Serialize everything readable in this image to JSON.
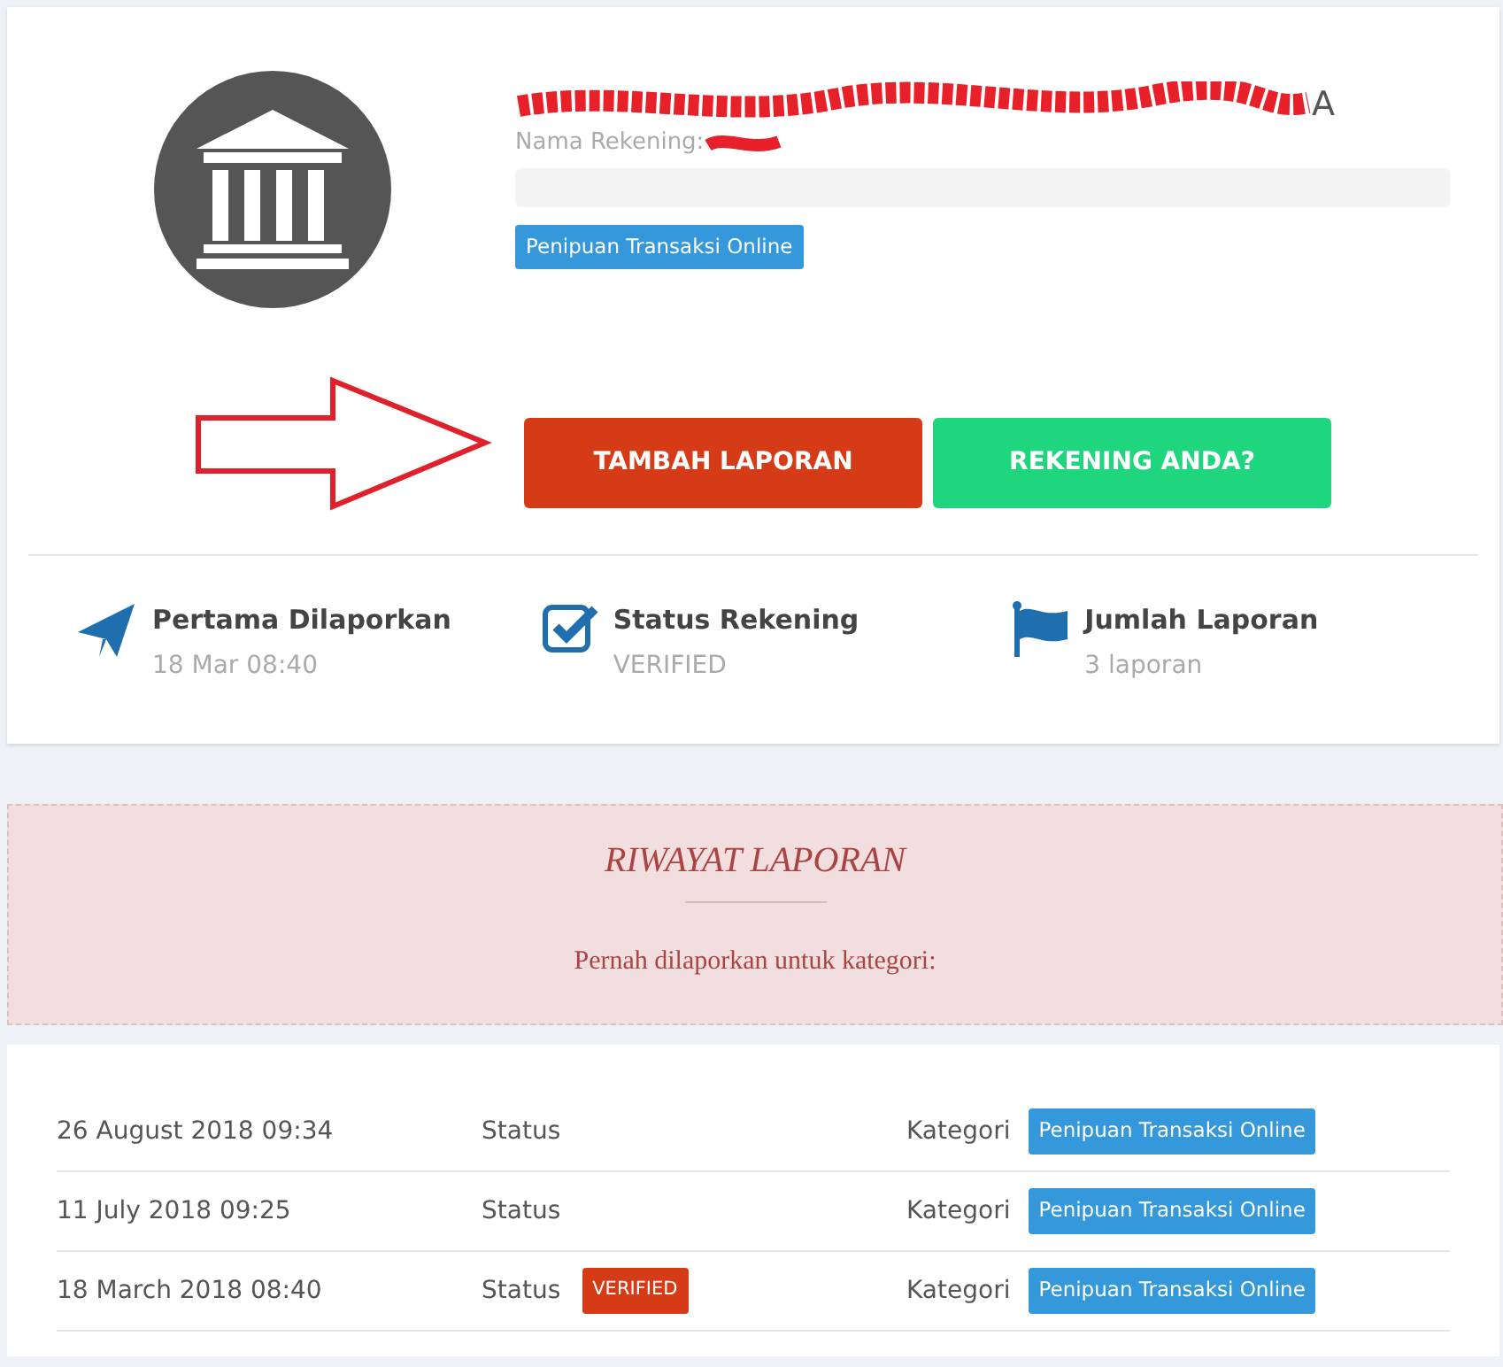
{
  "account": {
    "title_visible": "A",
    "name_label": "Nama Rekening:",
    "category_badge": "Penipuan Transaksi Online"
  },
  "buttons": [
    {
      "label": "TAMBAH LAPORAN",
      "kind": "danger"
    },
    {
      "label": "REKENING ANDA?",
      "kind": "success"
    }
  ],
  "stats": [
    {
      "title": "Pertama Dilaporkan",
      "value": "18 Mar 08:40"
    },
    {
      "title": "Status Rekening",
      "value": "VERIFIED"
    },
    {
      "title": "Jumlah Laporan",
      "value": "3 laporan"
    }
  ],
  "history": {
    "title": "RIWAYAT LAPORAN",
    "subtitle": "Pernah dilaporkan untuk kategori:"
  },
  "reports": [
    {
      "date": "26 August 2018 09:34",
      "status_label": "Status",
      "category_label": "Kategori",
      "category": "Penipuan Transaksi Online"
    },
    {
      "date": "11 July 2018 09:25",
      "status_label": "Status",
      "category_label": "Kategori",
      "category": "Penipuan Transaksi Online"
    },
    {
      "date": "18 March 2018 08:40",
      "status_label": "Status",
      "status_badge": "VERIFIED",
      "category_label": "Kategori",
      "category": "Penipuan Transaksi Online"
    }
  ]
}
